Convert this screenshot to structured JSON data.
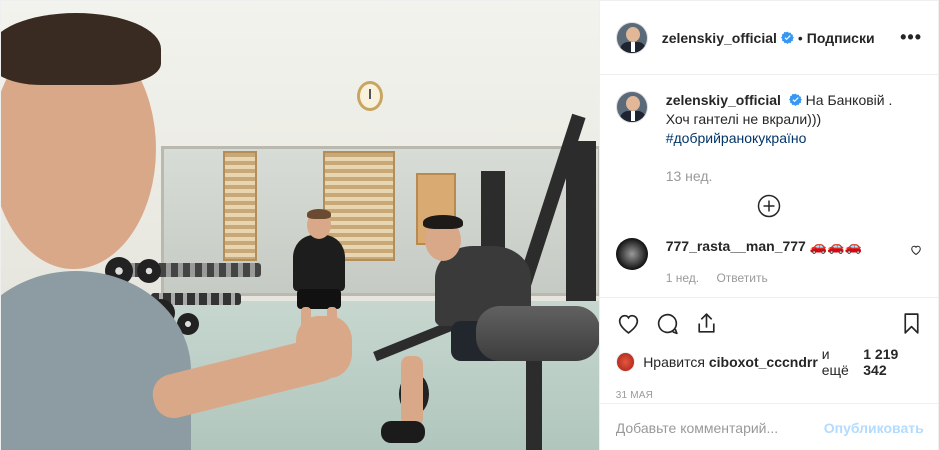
{
  "post": {
    "author": {
      "username": "zelenskiy_official",
      "verified": true,
      "avatar_icon": "person-avatar"
    },
    "follow_separator": "•",
    "follow_label": "Подписки",
    "more_label": "•••",
    "caption": {
      "username": "zelenskiy_official",
      "text": "На Банковій . Хоч гантелі не вкрали)))",
      "hashtag": "#добрийранокукраїно",
      "time": "13 нед."
    },
    "load_more_icon": "plus-circle-icon",
    "comments": [
      {
        "username": "777_rasta__man_777",
        "text": "🚗🚗🚗",
        "time": "1 нед.",
        "reply_label": "Ответить"
      }
    ],
    "likes": {
      "prefix": "Нравится",
      "user": "ciboxot_cccndrr",
      "middle": "и ещё",
      "count": "1 219 342"
    },
    "date": "31 мая",
    "comment_input": {
      "placeholder": "Добавьте комментарий...",
      "value": ""
    },
    "publish_label": "Опубликовать",
    "colors": {
      "verified": "#3897f0",
      "hashtag": "#003569",
      "muted": "#999999",
      "publish_disabled": "#b3dbff"
    }
  }
}
